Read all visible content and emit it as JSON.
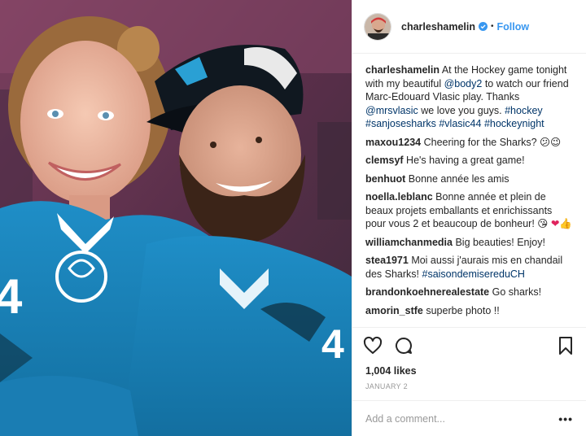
{
  "post": {
    "username": "charleshamelin",
    "follow_label": "Follow",
    "separator": "•",
    "caption": {
      "username": "charleshamelin",
      "text_1": "At the Hockey game tonight with my beautiful",
      "mention_1": "@body2",
      "text_2": "to watch our friend Marc-Edouard Vlasic play. Thanks",
      "mention_2": "@mrsvlasic",
      "text_3": "we love you guys.",
      "hashtags": [
        "#hockey",
        "#sanjosesharks",
        "#vlasic44",
        "#hockeynight"
      ]
    },
    "comments": [
      {
        "user": "maxou1234",
        "text": "Cheering for the Sharks?",
        "emoji": [
          "😕",
          "😉"
        ]
      },
      {
        "user": "clemsyf",
        "text": "He's having a great game!"
      },
      {
        "user": "benhuot",
        "text": "Bonne année les amis"
      },
      {
        "user": "noella.leblanc",
        "text": "Bonne année et plein de beaux projets emballants et enrichissants pour vous 2 et beaucoup de bonheur!",
        "emoji": [
          "😘",
          "❤",
          "👍"
        ]
      },
      {
        "user": "williamchanmedia",
        "text": "Big beauties! Enjoy!"
      },
      {
        "user": "stea1971",
        "text": "Moi aussi j'aurais mis en chandail des Sharks!",
        "link": "#saisondemisereduCH"
      },
      {
        "user": "brandonkoehnerealestate",
        "text": "Go sharks!"
      },
      {
        "user": "amorin_stfe",
        "text": "superbe photo !!"
      }
    ],
    "likes": "1,004 likes",
    "date": "JANUARY 2",
    "add_comment_placeholder": "Add a comment...",
    "more_label": "•••"
  },
  "icons": {
    "like": "heart-icon",
    "comment": "speech-bubble-icon",
    "save": "bookmark-icon",
    "verified": "verified-badge-icon"
  },
  "colors": {
    "follow": "#3897f0",
    "link": "#003569",
    "muted": "#999999",
    "verified": "#3897f0"
  }
}
